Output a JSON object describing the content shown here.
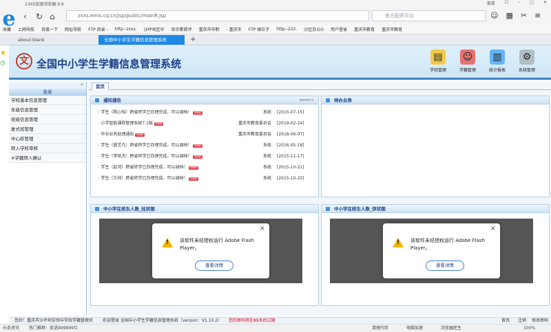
{
  "browser": {
    "title": "2345加速浏览器 9.6",
    "menu_label": "菜单",
    "url": "zxxs.emis.cq.cn/jsp/public/mainR.jsp",
    "search_placeholder": "官方配资平台",
    "favorites": [
      "收藏",
      "上网导航",
      "百度一下",
      "网址导航",
      "FTP 目录 -",
      "http--zxxs.",
      "沙坪坝区中",
      "综合素质评",
      "重庆市中职",
      "- 重庆市",
      "FTP 根位于",
      "http--222.",
      "沙区办公O",
      "用户登录",
      "重庆市教育",
      "重庆市教育"
    ],
    "tabs": [
      "about:blank",
      "全国中小学生学籍信息管理系统"
    ],
    "new_tab": "+"
  },
  "app": {
    "title": "全国中小学生学籍信息管理系统",
    "top_nav": [
      "学校管理",
      "学籍管理",
      "统计报表",
      "系统管理"
    ],
    "menu_header": "菜单",
    "menu_items": [
      "学校基本信息管理",
      "年级信息管理",
      "班级信息管理",
      "复式班管理",
      "中心校管理",
      "转入学校审核",
      "※学籍转入确认"
    ],
    "page_tab": "首页",
    "notice": {
      "title": "通知通告",
      "more": "more>>",
      "rows": [
        {
          "text": "学生（杨心怡）跨省转学已办理完成，可以调档！",
          "who": "系统",
          "date": "[2015-07-15]"
        },
        {
          "text": "小学智能课程管理系统7.1版",
          "who": "重庆市教育委员会",
          "date": "[2019-02-24]"
        },
        {
          "text": "毕业业务处理通知",
          "who": "重庆市教育委员会",
          "date": "[2018-06-07]"
        },
        {
          "text": "学生（盛艺凡）跨省转学已办理完成，可以调档！",
          "who": "系统",
          "date": "[2016-05-18]"
        },
        {
          "text": "学生（李依杰）跨省转学已办理完成，可以调档！",
          "who": "系统",
          "date": "[2015-11-17]"
        },
        {
          "text": "学生（赵鸿）跨省转学已办理完成，可以调档！",
          "who": "系统",
          "date": "[2015-10-21]"
        },
        {
          "text": "学生（方圳）跨省转学已办理完成，可以调档！",
          "who": "系统",
          "date": "[2015-10-20]"
        }
      ],
      "new_badge": "new"
    },
    "todo_title": "待办业务",
    "chart_left_title": "中小学在校生人数_柱状图",
    "chart_right_title": "中小学在校生人数_饼状图",
    "flash_message": "该软件未经授权运行 Adobe Flash Player。",
    "flash_button": "查看详情",
    "flash_close": "×"
  },
  "status": {
    "greeting": "您好！重庆市沙坪坝实验中学校学籍管理员",
    "welcome": "欢迎登录 全国中小学生学籍信息管理系统（version：V1.10.2）",
    "warning": "您的密码将在89天后过期",
    "home": "首页",
    "logout": "注销",
    "change_pwd": "修改密码"
  },
  "browser_status": {
    "news": "头条资讯",
    "hot": "热门推荐：奕语999999亿",
    "items": [
      "清理内存",
      "电脑加速",
      "浏览器医生",
      "100%"
    ]
  },
  "colors": {
    "accent": "#1e88e5",
    "brand": "#1d3f8a",
    "new_badge": "#e5484d",
    "warning": "#d0021b"
  }
}
